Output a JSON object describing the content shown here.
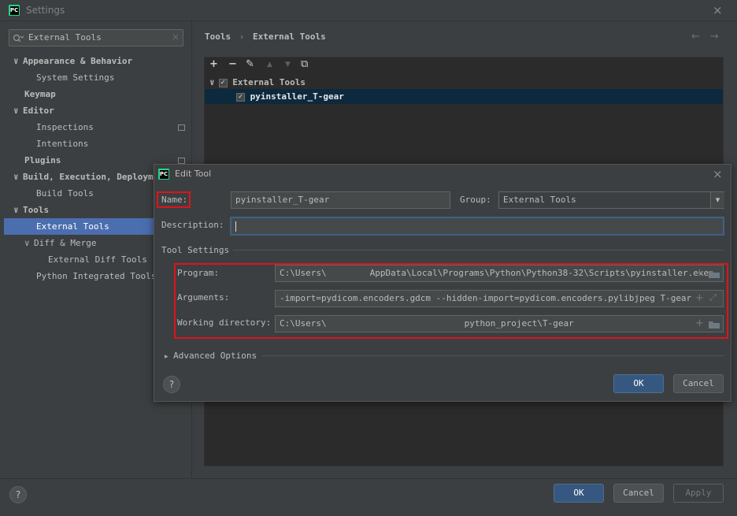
{
  "window": {
    "title": "Settings",
    "close_glyph": "×"
  },
  "search": {
    "value": "External Tools",
    "clear_glyph": "×"
  },
  "tree": {
    "items": [
      {
        "label": "Appearance & Behavior",
        "chevron": "∨",
        "bold": true
      },
      {
        "label": "System Settings"
      },
      {
        "label": "Keymap",
        "bold": true
      },
      {
        "label": "Editor",
        "chevron": "∨",
        "bold": true
      },
      {
        "label": "Inspections"
      },
      {
        "label": "Intentions"
      },
      {
        "label": "Plugins",
        "bold": true
      },
      {
        "label": "Build, Execution, Deployme",
        "chevron": "∨",
        "bold": true
      },
      {
        "label": "Build Tools"
      },
      {
        "label": "Tools",
        "chevron": "∨",
        "bold": true
      },
      {
        "label": "External Tools",
        "selected": true
      },
      {
        "label": "Diff & Merge",
        "chevron": "∨"
      },
      {
        "label": "External Diff Tools"
      },
      {
        "label": "Python Integrated Tools"
      }
    ]
  },
  "breadcrumb": {
    "parent": "Tools",
    "separator": "›",
    "current": "External Tools"
  },
  "nav": {
    "back": "←",
    "forward": "→"
  },
  "toolbar": {
    "add": "+",
    "remove": "−",
    "edit": "✎",
    "up": "▲",
    "down": "▼",
    "copy": "⧉"
  },
  "tools_tree": {
    "group": {
      "label": "External Tools",
      "checked": "✓",
      "chevron": "∨"
    },
    "item": {
      "label": "pyinstaller_T-gear",
      "checked": "✓"
    }
  },
  "dialog": {
    "title": "Edit Tool",
    "close_glyph": "×",
    "name_label": "Name:",
    "name_value": "pyinstaller_T-gear",
    "group_label": "Group:",
    "group_value": "External Tools",
    "group_arrow": "▾",
    "description_label": "Description:",
    "description_value": "",
    "tool_settings_label": "Tool Settings",
    "program_label": "Program:",
    "program_value_a": "C:\\Users\\",
    "program_value_b": "AppData\\Local\\Programs\\Python\\Python38-32\\Scripts\\pyinstaller.exe",
    "arguments_label": "Arguments:",
    "arguments_value": "-import=pydicom.encoders.gdcm --hidden-import=pydicom.encoders.pylibjpeg T-gear.py",
    "workdir_label": "Working directory:",
    "workdir_value_a": "C:\\Users\\",
    "workdir_value_b": "python_project\\T-gear",
    "plus_glyph": "+",
    "expand_glyph": "⤢",
    "advanced_label": "Advanced Options",
    "advanced_arrow": "▸",
    "help": "?",
    "ok": "OK",
    "cancel": "Cancel"
  },
  "footer": {
    "help": "?",
    "ok": "OK",
    "cancel": "Cancel",
    "apply": "Apply"
  },
  "colors": {
    "background": "#3c3f41",
    "selection": "#4b6eaf",
    "list_selection": "#0d293e",
    "primary_button": "#365880",
    "highlight_box": "#e0131a",
    "pycharm_logo": "#21d789"
  },
  "icons": {
    "logo": "pycharm-logo-icon",
    "search": "search-icon",
    "project_scope": "project-scope-icon"
  }
}
